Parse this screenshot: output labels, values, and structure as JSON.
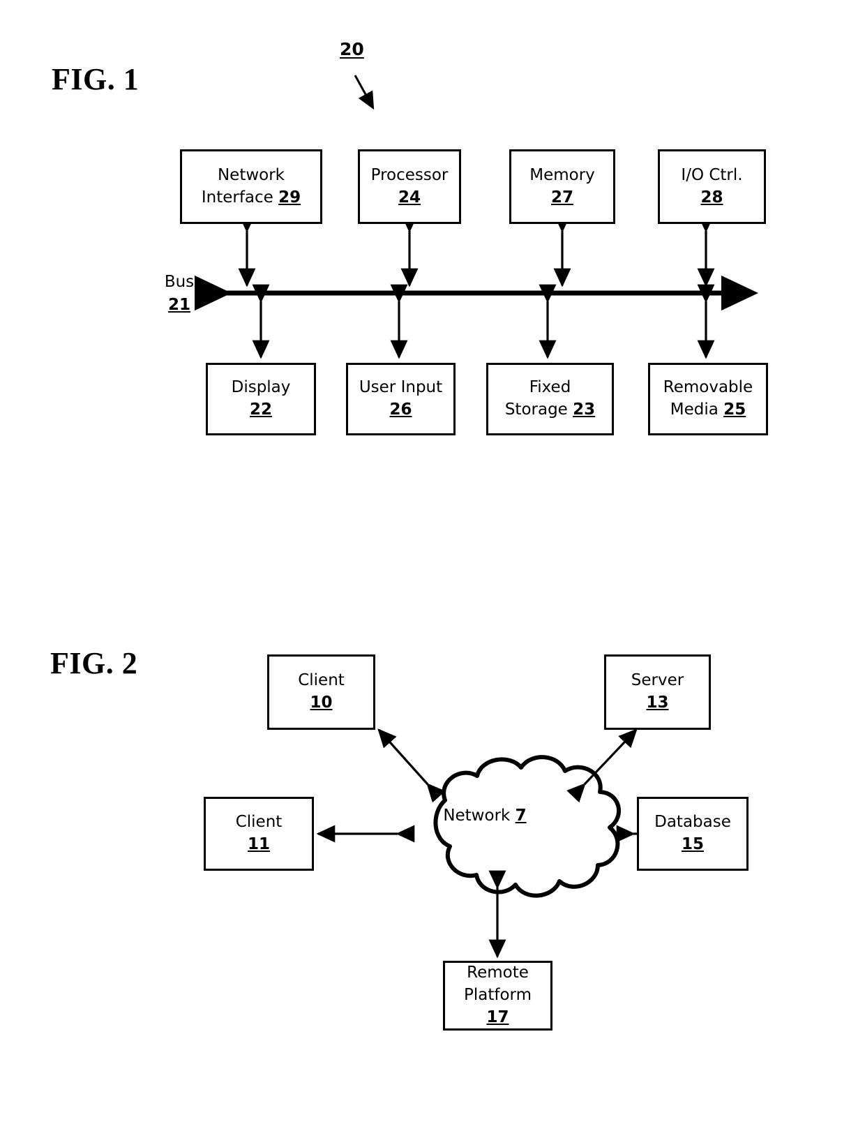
{
  "figures": {
    "fig1": {
      "title": "FIG. 1",
      "lead_ref": "20",
      "bus": {
        "label": "Bus",
        "ref": "21"
      },
      "top_row": [
        {
          "name": "network-interface",
          "line1": "Network",
          "line2": "Interface",
          "ref": "29"
        },
        {
          "name": "processor",
          "line1": "Processor",
          "line2": "",
          "ref": "24"
        },
        {
          "name": "memory",
          "line1": "Memory",
          "line2": "",
          "ref": "27"
        },
        {
          "name": "io-ctrl",
          "line1": "I/O Ctrl.",
          "line2": "",
          "ref": "28"
        }
      ],
      "bottom_row": [
        {
          "name": "display",
          "line1": "Display",
          "line2": "",
          "ref": "22"
        },
        {
          "name": "user-input",
          "line1": "User Input",
          "line2": "",
          "ref": "26"
        },
        {
          "name": "fixed-storage",
          "line1": "Fixed",
          "line2": "Storage",
          "ref": "23"
        },
        {
          "name": "removable-media",
          "line1": "Removable",
          "line2": "Media",
          "ref": "25"
        }
      ]
    },
    "fig2": {
      "title": "FIG. 2",
      "cloud": {
        "label": "Network",
        "ref": "7"
      },
      "nodes": [
        {
          "name": "client-10",
          "line1": "Client",
          "line2": "",
          "ref": "10"
        },
        {
          "name": "server-13",
          "line1": "Server",
          "line2": "",
          "ref": "13"
        },
        {
          "name": "client-11",
          "line1": "Client",
          "line2": "",
          "ref": "11"
        },
        {
          "name": "database-15",
          "line1": "Database",
          "line2": "",
          "ref": "15"
        },
        {
          "name": "remote-platform",
          "line1": "Remote",
          "line2": "Platform",
          "ref": "17"
        }
      ]
    }
  },
  "colors": {
    "ink": "#000000",
    "paper": "#ffffff"
  }
}
